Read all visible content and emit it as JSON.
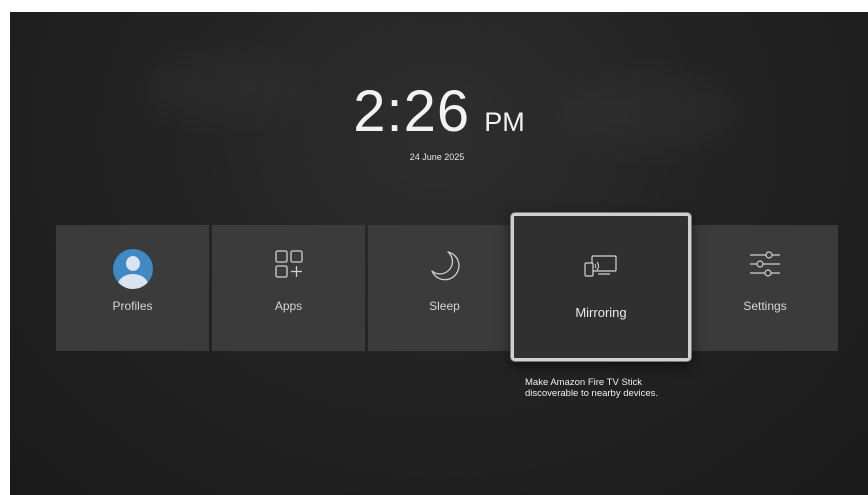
{
  "clock": {
    "time": "2:26",
    "ampm": "PM",
    "date": "24 June 2025"
  },
  "tiles": [
    {
      "label": "Profiles",
      "icon": "profile-avatar-icon"
    },
    {
      "label": "Apps",
      "icon": "apps-grid-icon"
    },
    {
      "label": "Sleep",
      "icon": "moon-icon"
    },
    {
      "label": "Mirroring",
      "icon": "mirroring-icon",
      "focused": true
    },
    {
      "label": "Settings",
      "icon": "sliders-icon"
    }
  ],
  "focused_description": "Make Amazon Fire TV Stick discoverable to nearby devices.",
  "colors": {
    "background": "#232323",
    "tile": "#3b3b3b",
    "focus_border": "#cfcfcf",
    "avatar": "#3f89c4"
  }
}
